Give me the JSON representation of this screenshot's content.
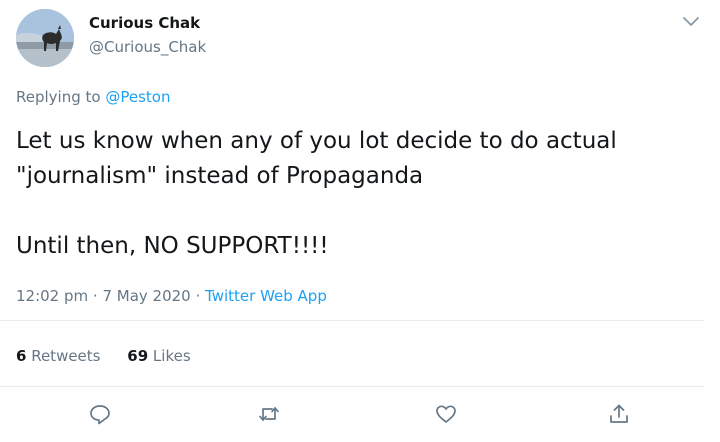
{
  "author": {
    "display_name": "Curious Chak",
    "handle": "@Curious_Chak"
  },
  "reply": {
    "prefix": "Replying to ",
    "to": "@Peston"
  },
  "tweet": {
    "line1": "Let us know when any of you lot decide to do actual",
    "line2": "\"journalism\" instead of Propaganda",
    "line3": "Until then, NO SUPPORT!!!!"
  },
  "meta": {
    "time": "12:02 pm",
    "sep1": " · ",
    "date": "7 May 2020",
    "sep2": " · ",
    "source": "Twitter Web App"
  },
  "stats": {
    "retweets_count": "6",
    "retweets_label": " Retweets",
    "likes_count": "69",
    "likes_label": " Likes"
  },
  "icons": {
    "reply": "reply-icon",
    "retweet": "retweet-icon",
    "like": "heart-icon",
    "share": "share-icon",
    "menu": "chevron-down-icon"
  },
  "colors": {
    "accent": "#1da1f2",
    "secondary_text": "#657786",
    "primary_text": "#14171a",
    "divider": "#e6ecf0"
  }
}
